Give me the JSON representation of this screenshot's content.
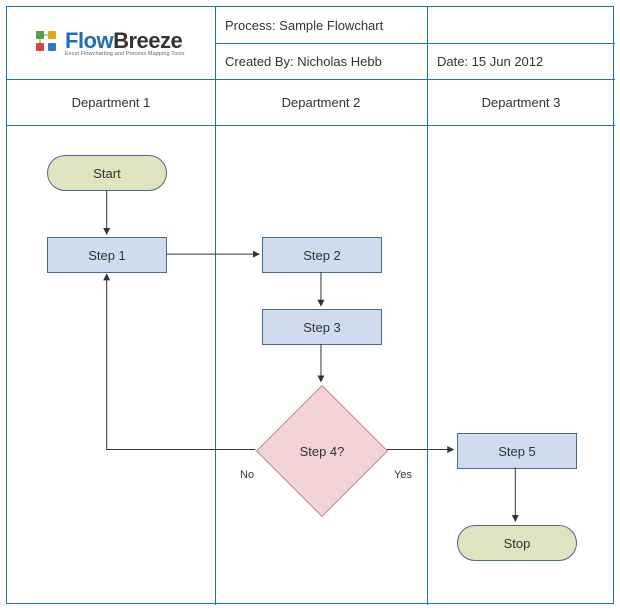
{
  "logo": {
    "name_part1": "Flow",
    "name_part2": "Breeze",
    "tagline": "Excel Flowcharting and Process Mapping Tools"
  },
  "meta": {
    "process_label": "Process: Sample Flowchart",
    "created_by_label": "Created By: Nicholas Hebb",
    "date_label": "Date: 15 Jun 2012"
  },
  "lanes": {
    "dept1": "Department 1",
    "dept2": "Department 2",
    "dept3": "Department 3"
  },
  "nodes": {
    "start": "Start",
    "step1": "Step 1",
    "step2": "Step 2",
    "step3": "Step 3",
    "step4": "Step 4?",
    "step5": "Step 5",
    "stop": "Stop"
  },
  "branches": {
    "no": "No",
    "yes": "Yes"
  }
}
